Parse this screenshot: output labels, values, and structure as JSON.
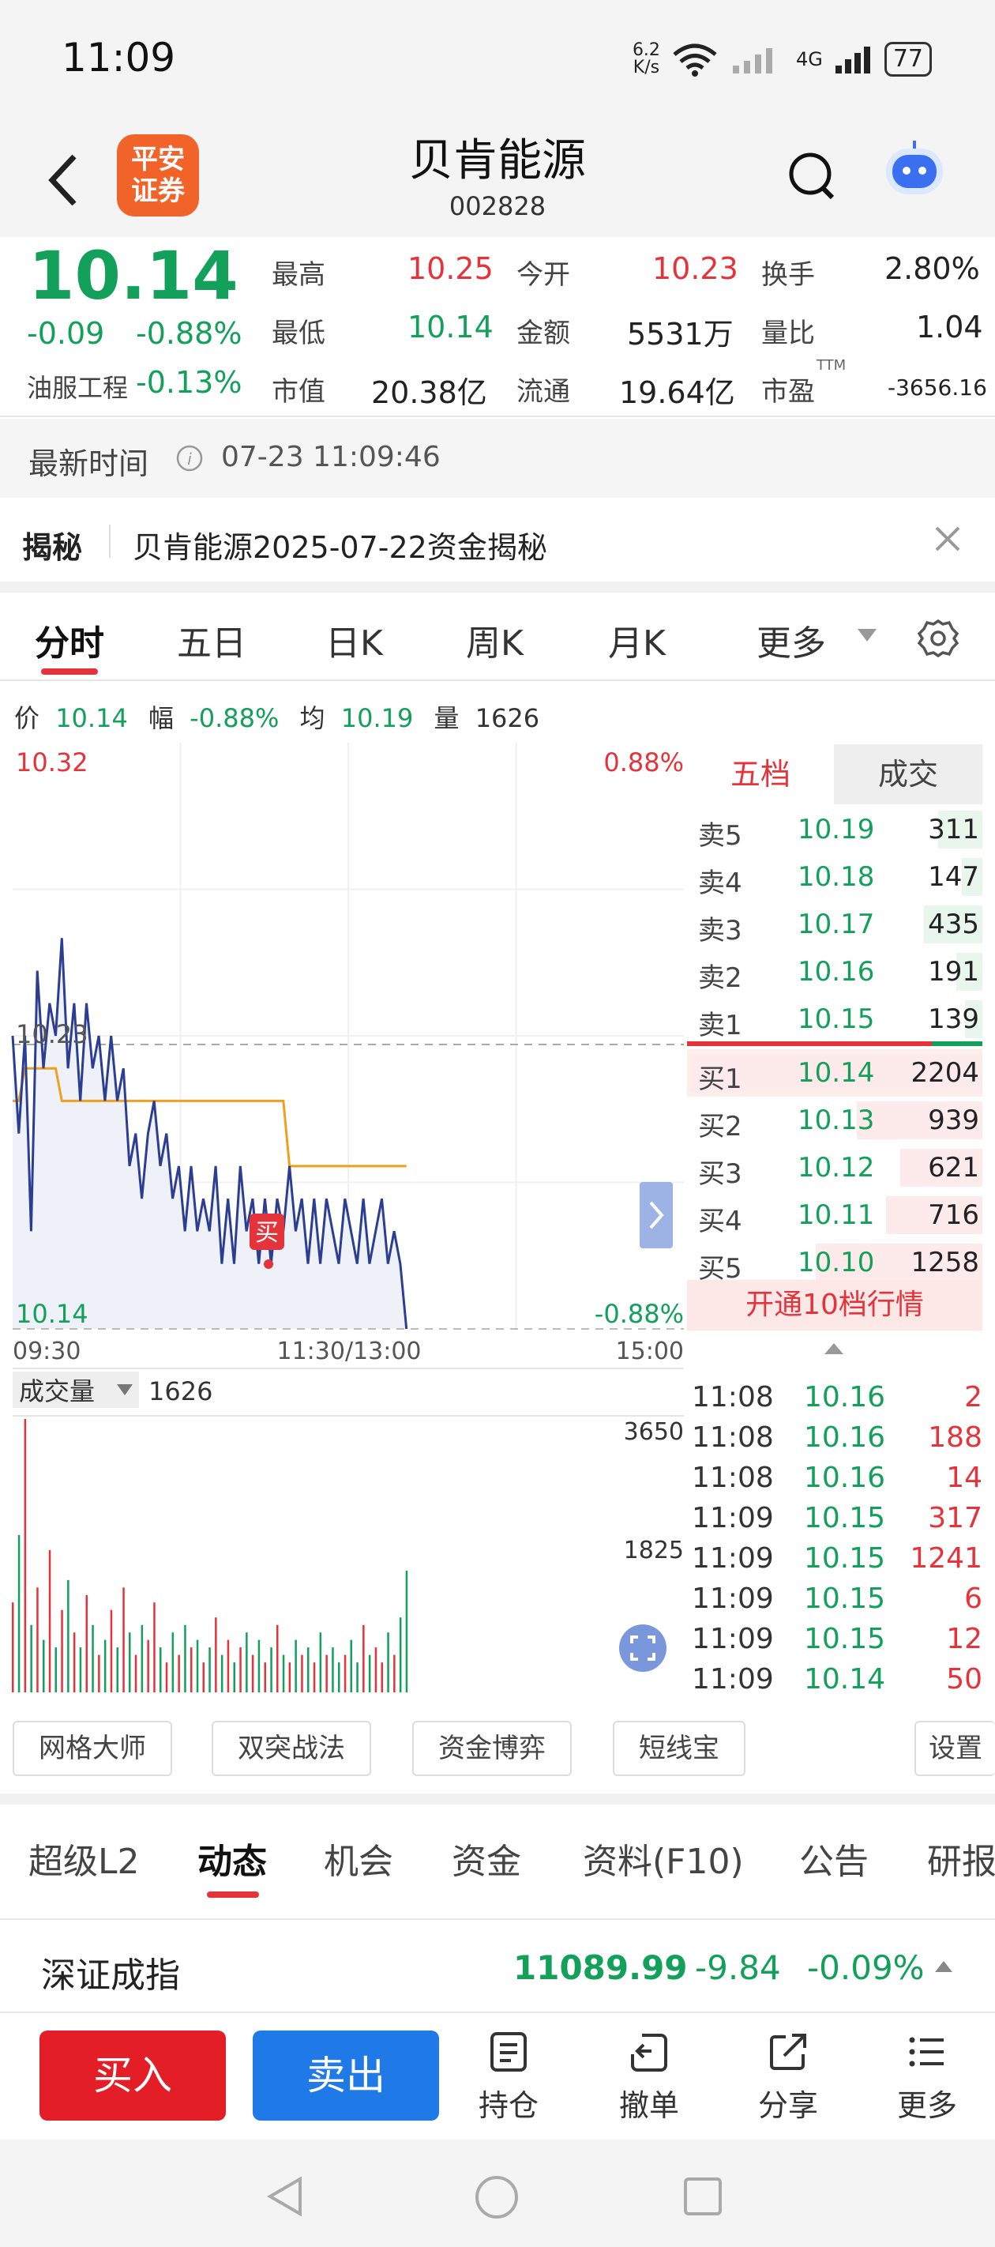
{
  "status_bar": {
    "time": "11:09",
    "net_speed": "6.2\nK/s",
    "net_speed_top": "6.2",
    "net_speed_bottom": "K/s",
    "signal_label": "4G",
    "battery": "77"
  },
  "header": {
    "logo_line1": "平安",
    "logo_line2": "证券",
    "stock_name": "贝肯能源",
    "stock_code": "002828"
  },
  "quote": {
    "price": "10.14",
    "change": "-0.09",
    "change_pct": "-0.88%",
    "sector_name": "油服工程",
    "sector_pct": "-0.13%",
    "high_label": "最高",
    "high": "10.25",
    "low_label": "最低",
    "low": "10.14",
    "mcap_label": "市值",
    "mcap": "20.38亿",
    "open_label": "今开",
    "open": "10.23",
    "amount_label": "金额",
    "amount": "5531万",
    "float_label": "流通",
    "float": "19.64亿",
    "turnover_label": "换手",
    "turnover": "2.80%",
    "vol_ratio_label": "量比",
    "vol_ratio": "1.04",
    "pe_label": "市盈",
    "pe_sup": "TTM",
    "pe": "-3656.16"
  },
  "latest_time": {
    "label": "最新时间",
    "value": "07-23 11:09:46"
  },
  "secret": {
    "tag": "揭秘",
    "text": "贝肯能源2025-07-22资金揭秘"
  },
  "chart_tabs": [
    "分时",
    "五日",
    "日K",
    "周K",
    "月K",
    "更多"
  ],
  "info_line": {
    "price_label": "价",
    "price": "10.14",
    "pct_label": "幅",
    "pct": "-0.88%",
    "avg_label": "均",
    "avg": "10.19",
    "vol_label": "量",
    "vol": "1626"
  },
  "chart_labels": {
    "y_top": "10.32",
    "y_top_pct": "0.88%",
    "y_mid": "10.23",
    "y_bottom": "10.14",
    "y_bottom_pct": "-0.88%",
    "x_start": "09:30",
    "x_mid": "11:30/13:00",
    "x_end": "15:00",
    "buy_marker": "买",
    "volume_label": "成交量",
    "volume_value": "1626",
    "vol_max": "3650",
    "vol_mid": "1825"
  },
  "chart_data": {
    "type": "line",
    "title": "",
    "ylim": [
      10.14,
      10.32
    ],
    "prev_close": 10.23,
    "x_range": [
      "09:30",
      "15:00"
    ],
    "series": [
      {
        "name": "价",
        "values": [
          10.23,
          10.2,
          10.23,
          10.17,
          10.25,
          10.22,
          10.24,
          10.23,
          10.26,
          10.22,
          10.24,
          10.21,
          10.24,
          10.22,
          10.23,
          10.21,
          10.23,
          10.21,
          10.22,
          10.19,
          10.2,
          10.18,
          10.2,
          10.21,
          10.19,
          10.2,
          10.18,
          10.19,
          10.17,
          10.19,
          10.17,
          10.18,
          10.17,
          10.19,
          10.16,
          10.18,
          10.16,
          10.19,
          10.17,
          10.18,
          10.16,
          10.18,
          10.16,
          10.18,
          10.17,
          10.19,
          10.17,
          10.18,
          10.16,
          10.18,
          10.16,
          10.18,
          10.17,
          10.16,
          10.18,
          10.17,
          10.16,
          10.18,
          10.16,
          10.17,
          10.18,
          10.16,
          10.17,
          10.16,
          10.14
        ],
        "color": "#2c3e91"
      },
      {
        "name": "均",
        "values": [
          10.21,
          10.21,
          10.22,
          10.22,
          10.22,
          10.22,
          10.22,
          10.22,
          10.21,
          10.21,
          10.21,
          10.21,
          10.21,
          10.21,
          10.21,
          10.21,
          10.21,
          10.21,
          10.21,
          10.21,
          10.21,
          10.21,
          10.21,
          10.21,
          10.21,
          10.21,
          10.21,
          10.21,
          10.21,
          10.21,
          10.21,
          10.21,
          10.21,
          10.21,
          10.21,
          10.21,
          10.21,
          10.21,
          10.21,
          10.21,
          10.21,
          10.21,
          10.21,
          10.21,
          10.21,
          10.19,
          10.19,
          10.19,
          10.19,
          10.19,
          10.19,
          10.19,
          10.19,
          10.19,
          10.19,
          10.19,
          10.19,
          10.19,
          10.19,
          10.19,
          10.19,
          10.19,
          10.19,
          10.19,
          10.19
        ],
        "color": "#f0a020"
      }
    ],
    "volume": {
      "ylim": [
        0,
        3650
      ],
      "values": [
        1200,
        2100,
        3650,
        900,
        1400,
        700,
        1900,
        600,
        1100,
        1500,
        800,
        600,
        1300,
        900,
        500,
        700,
        1100,
        600,
        1400,
        800,
        500,
        900,
        700,
        1200,
        600,
        400,
        800,
        500,
        900,
        600,
        700,
        400,
        600,
        1000,
        500,
        700,
        400,
        600,
        800,
        500,
        700,
        400,
        600,
        900,
        500,
        400,
        700,
        500,
        600,
        400,
        800,
        500,
        600,
        400,
        500,
        700,
        400,
        900,
        500,
        600,
        400,
        800,
        500,
        1000,
        1626
      ]
    }
  },
  "order_book": {
    "tab_active": "五档",
    "tab_other": "成交",
    "asks": [
      {
        "label": "卖5",
        "price": "10.19",
        "vol": "311",
        "bar": 0.15
      },
      {
        "label": "卖4",
        "price": "10.18",
        "vol": "147",
        "bar": 0.07
      },
      {
        "label": "卖3",
        "price": "10.17",
        "vol": "435",
        "bar": 0.2
      },
      {
        "label": "卖2",
        "price": "10.16",
        "vol": "191",
        "bar": 0.09
      },
      {
        "label": "卖1",
        "price": "10.15",
        "vol": "139",
        "bar": 0.06
      }
    ],
    "bids": [
      {
        "label": "买1",
        "price": "10.14",
        "vol": "2204",
        "bar": 1.0
      },
      {
        "label": "买2",
        "price": "10.13",
        "vol": "939",
        "bar": 0.43
      },
      {
        "label": "买3",
        "price": "10.12",
        "vol": "621",
        "bar": 0.28
      },
      {
        "label": "买4",
        "price": "10.11",
        "vol": "716",
        "bar": 0.33
      },
      {
        "label": "买5",
        "price": "10.10",
        "vol": "1258",
        "bar": 0.57
      }
    ],
    "open_10": "开通10档行情"
  },
  "ticks": [
    {
      "time": "11:08",
      "price": "10.16",
      "vol": "2"
    },
    {
      "time": "11:08",
      "price": "10.16",
      "vol": "188"
    },
    {
      "time": "11:08",
      "price": "10.16",
      "vol": "14"
    },
    {
      "time": "11:09",
      "price": "10.15",
      "vol": "317"
    },
    {
      "time": "11:09",
      "price": "10.15",
      "vol": "1241"
    },
    {
      "time": "11:09",
      "price": "10.15",
      "vol": "6"
    },
    {
      "time": "11:09",
      "price": "10.15",
      "vol": "12"
    },
    {
      "time": "11:09",
      "price": "10.14",
      "vol": "50"
    }
  ],
  "tools": [
    "网格大师",
    "双突战法",
    "资金博弈",
    "短线宝",
    "设置"
  ],
  "bottom_tabs": [
    "超级L2",
    "动态",
    "机会",
    "资金",
    "资料(F10)",
    "公告",
    "研报"
  ],
  "index": {
    "name": "深证成指",
    "value": "11089.99",
    "change": "-9.84",
    "pct": "-0.09%"
  },
  "actions": {
    "buy": "买入",
    "sell": "卖出",
    "hold": "持仓",
    "cancel": "撤单",
    "share": "分享",
    "more": "更多"
  },
  "colors": {
    "up": "#e5333b",
    "down": "#12a05a",
    "buy_button": "#e41e27",
    "sell_button": "#1f7ae8",
    "price_line": "#2c3e91",
    "avg_line": "#f0a020",
    "logo": "#f2632a"
  }
}
